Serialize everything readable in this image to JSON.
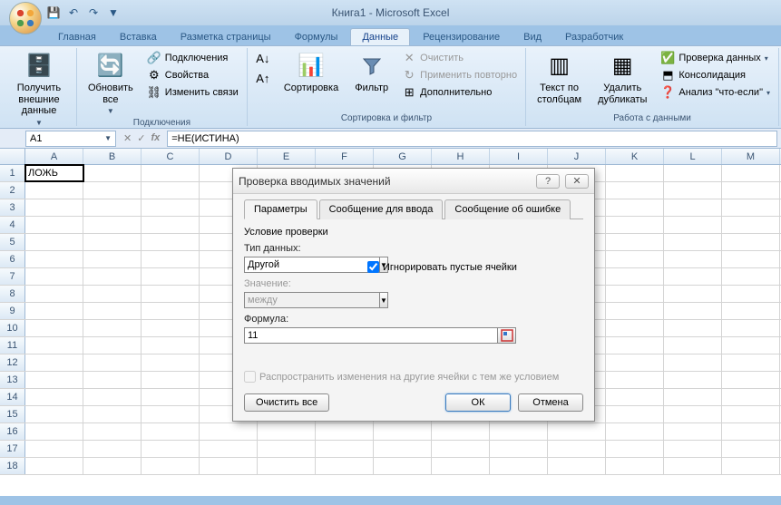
{
  "title": "Книга1 - Microsoft Excel",
  "tabs": {
    "home": "Главная",
    "insert": "Вставка",
    "layout": "Разметка страницы",
    "formulas": "Формулы",
    "data": "Данные",
    "review": "Рецензирование",
    "view": "Вид",
    "developer": "Разработчик"
  },
  "ribbon": {
    "getdata": {
      "label": "Получить\nвнешние данные"
    },
    "connections": {
      "refresh": "Обновить\nвсе",
      "conn": "Подключения",
      "props": "Свойства",
      "editlinks": "Изменить связи",
      "group": "Подключения"
    },
    "sort": {
      "sort": "Сортировка",
      "filter": "Фильтр",
      "clear": "Очистить",
      "reapply": "Применить повторно",
      "advanced": "Дополнительно",
      "group": "Сортировка и фильтр"
    },
    "datatools": {
      "t2c": "Текст по\nстолбцам",
      "dedup": "Удалить\nдубликаты",
      "validation": "Проверка данных",
      "consolidate": "Консолидация",
      "whatif": "Анализ \"что-если\"",
      "group": "Работа с данными"
    }
  },
  "namebox": "A1",
  "formula": "=НЕ(ИСТИНА)",
  "columns": [
    "A",
    "B",
    "C",
    "D",
    "E",
    "F",
    "G",
    "H",
    "I",
    "J",
    "K",
    "L",
    "M"
  ],
  "cellA1": "ЛОЖЬ",
  "dialog": {
    "title": "Проверка вводимых значений",
    "tabs": {
      "params": "Параметры",
      "input": "Сообщение для ввода",
      "error": "Сообщение об ошибке"
    },
    "section": "Условие проверки",
    "type_label": "Тип данных:",
    "type_value": "Другой",
    "ignore_blank": "Игнорировать пустые ячейки",
    "value_label": "Значение:",
    "value_value": "между",
    "formula_label": "Формула:",
    "formula_value": "11",
    "propagate": "Распространить изменения на другие ячейки с тем же условием",
    "clear": "Очистить все",
    "ok": "ОК",
    "cancel": "Отмена"
  }
}
